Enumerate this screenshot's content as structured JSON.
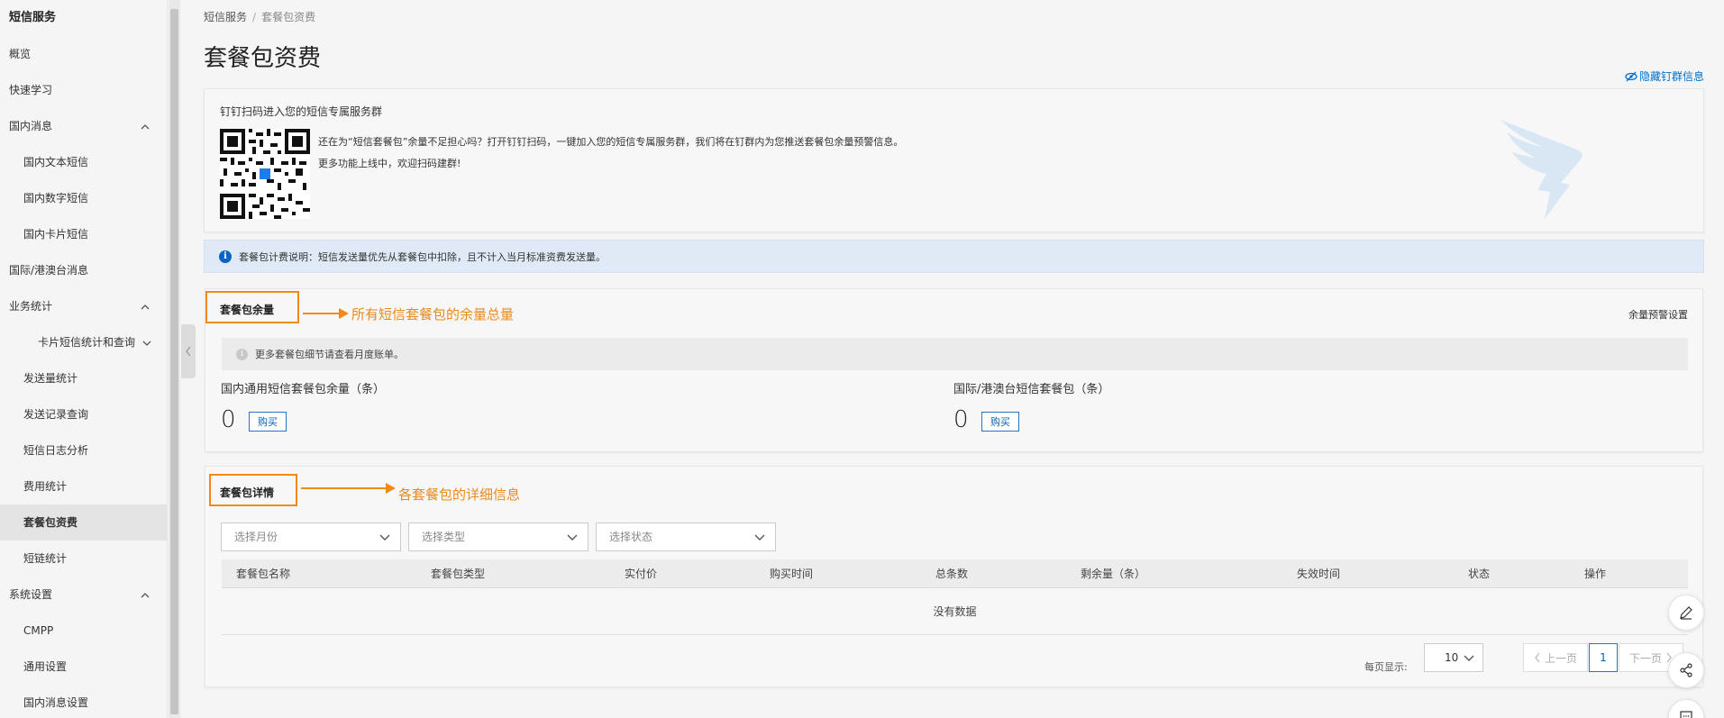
{
  "sidebar": {
    "title": "短信服务",
    "items": [
      {
        "label": "概览",
        "level": 0
      },
      {
        "label": "快速学习",
        "level": 0
      },
      {
        "label": "国内消息",
        "level": 0,
        "expanded": true
      },
      {
        "label": "国内文本短信",
        "level": 1
      },
      {
        "label": "国内数字短信",
        "level": 1
      },
      {
        "label": "国内卡片短信",
        "level": 1
      },
      {
        "label": "国际/港澳台消息",
        "level": 0
      },
      {
        "label": "业务统计",
        "level": 0,
        "expanded": true
      },
      {
        "label": "卡片短信统计和查询",
        "level": 2,
        "expanded": false
      },
      {
        "label": "发送量统计",
        "level": 1
      },
      {
        "label": "发送记录查询",
        "level": 1
      },
      {
        "label": "短信日志分析",
        "level": 1
      },
      {
        "label": "费用统计",
        "level": 1
      },
      {
        "label": "套餐包资费",
        "level": 1,
        "active": true
      },
      {
        "label": "短链统计",
        "level": 1
      },
      {
        "label": "系统设置",
        "level": 0,
        "expanded": true
      },
      {
        "label": "CMPP",
        "level": 1
      },
      {
        "label": "通用设置",
        "level": 1
      },
      {
        "label": "国内消息设置",
        "level": 1
      }
    ]
  },
  "breadcrumb": {
    "root": "短信服务",
    "separator": "/",
    "current": "套餐包资费"
  },
  "page": {
    "title": "套餐包资费",
    "hide_dingtalk": "隐藏钉群信息"
  },
  "dingtalk": {
    "title": "钉钉扫码进入您的短信专属服务群",
    "text1": "还在为“短信套餐包”余量不足担心吗？打开钉钉扫码，一键加入您的短信专属服务群，我们将在钉群内为您推送套餐包余量预警信息。",
    "text2": "更多功能上线中，欢迎扫码建群!"
  },
  "notice": {
    "text": "套餐包计费说明：短信发送量优先从套餐包中扣除，且不计入当月标准资费发送量。"
  },
  "balance": {
    "title": "套餐包余量",
    "annotation": "所有短信套餐包的余量总量",
    "alert_link": "余量预警设置",
    "tip": "更多套餐包细节请查看月度账单。",
    "domestic_label": "国内通用短信套餐包余量（条）",
    "domestic_value": "0",
    "intl_label": "国际/港澳台短信套餐包（条）",
    "intl_value": "0",
    "buy_label": "购买"
  },
  "details": {
    "title": "套餐包详情",
    "annotation": "各套餐包的详细信息",
    "filters": {
      "month": "选择月份",
      "type": "选择类型",
      "status": "选择状态"
    },
    "columns": [
      "套餐包名称",
      "套餐包类型",
      "实付价",
      "购买时间",
      "总条数",
      "剩余量（条）",
      "失效时间",
      "状态",
      "操作"
    ],
    "empty_text": "没有数据",
    "pagination": {
      "per_page_label": "每页显示:",
      "per_page_value": "10",
      "prev": "上一页",
      "current": "1",
      "next": "下一页"
    }
  },
  "colors": {
    "accent": "#0a5fb4",
    "annotation": "#f08a15",
    "notice_bg": "#dfeaf6"
  }
}
